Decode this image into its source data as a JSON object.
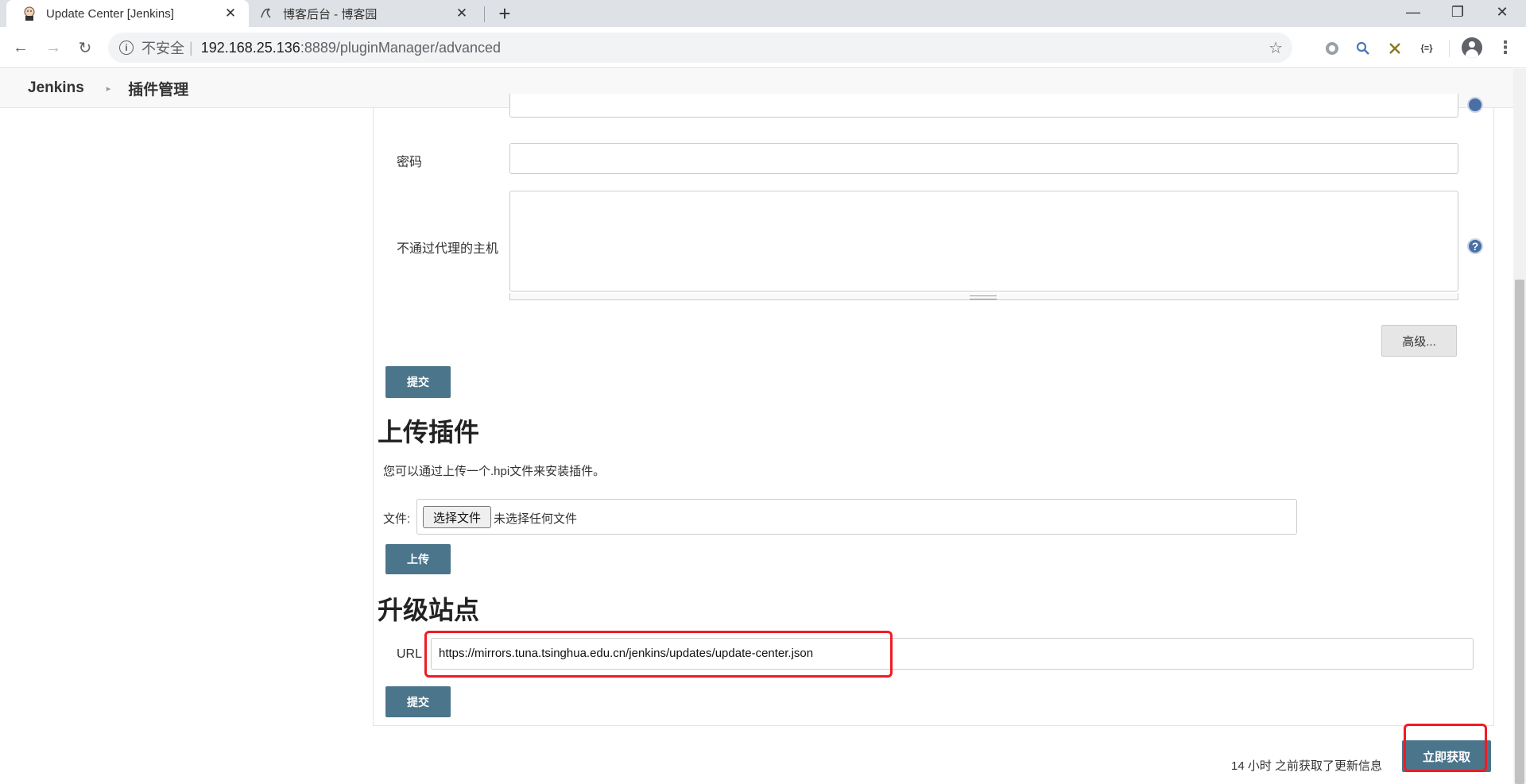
{
  "browser": {
    "tabs": [
      {
        "title": "Update Center [Jenkins]",
        "active": true,
        "favicon": "jenkins-butler-icon"
      },
      {
        "title": "博客后台 - 博客园",
        "active": false,
        "favicon": "cnblogs-icon"
      }
    ],
    "new_tab": "+",
    "window_controls": {
      "minimize": "—",
      "restore": "❐",
      "close": "✕"
    },
    "nav": {
      "back": "←",
      "forward": "→",
      "reload": "↻"
    },
    "address": {
      "security_label": "不安全",
      "separator": "|",
      "host": "192.168.25.136",
      "rest": ":8889/pluginManager/advanced"
    },
    "bookmark_icon": "☆",
    "menu": "⋮"
  },
  "breadcrumbs": {
    "root": "Jenkins",
    "arrow": "▸",
    "current": "插件管理"
  },
  "proxy": {
    "password_label": "密码",
    "password_value": "",
    "no_proxy_label": "不通过代理的主机",
    "no_proxy_value": "",
    "help": "?",
    "advanced_button": "高级...",
    "submit_button": "提交"
  },
  "upload": {
    "heading": "上传插件",
    "description": "您可以通过上传一个.hpi文件来安装插件。",
    "file_label": "文件:",
    "choose_button": "选择文件",
    "no_file": "未选择任何文件",
    "upload_button": "上传"
  },
  "update_site": {
    "heading": "升级站点",
    "url_label": "URL",
    "url_value": "https://mirrors.tuna.tsinghua.edu.cn/jenkins/updates/update-center.json",
    "submit_button": "提交"
  },
  "footer": {
    "last_update_text": "14 小时 之前获取了更新信息",
    "fetch_now_button": "立即获取"
  },
  "colors": {
    "primary_button": "#4b758b",
    "highlight_box": "#ee1c25",
    "help_icon": "#4a6fa5"
  }
}
